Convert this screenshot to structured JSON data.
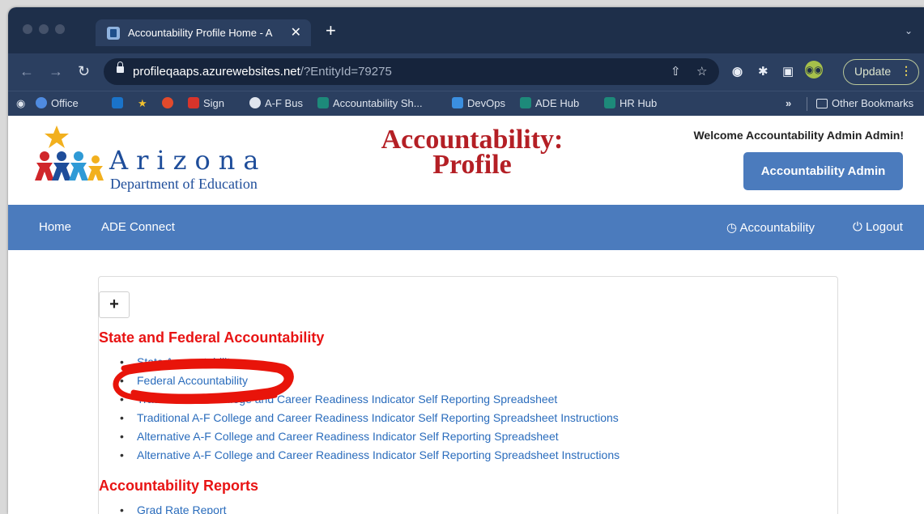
{
  "browser": {
    "tab_title": "Accountability Profile Home - A",
    "tab_close": "✕",
    "new_tab": "+",
    "url_host": "profileqaaps.azurewebsites.net",
    "url_path": "/?EntityId=79275",
    "update_label": "Update",
    "update_menu": "⋮",
    "bookmarks": [
      "Office",
      "Sign",
      "A-F Bus",
      "Accountability Sh...",
      "DevOps",
      "ADE Hub",
      "HR Hub"
    ],
    "more_bookmarks": "»",
    "other_bookmarks": "Other Bookmarks"
  },
  "header": {
    "logo_word": "Arizona",
    "logo_dept": "Department of Education",
    "site_title_1": "Accountability:",
    "site_title_2": "Profile",
    "welcome": "Welcome Accountability Admin Admin!",
    "role_button": "Accountability Admin"
  },
  "nav": {
    "home": "Home",
    "ade_connect": "ADE Connect",
    "accountability": "Accountability",
    "logout": "Logout"
  },
  "content": {
    "expand_button": "+",
    "section1_title": "State and Federal Accountability",
    "section1_items": [
      "State Accountability",
      "Federal Accountability",
      "Traditional A-F College and Career Readiness Indicator Self Reporting Spreadsheet",
      "Traditional A-F College and Career Readiness Indicator Self Reporting Spreadsheet Instructions",
      "Alternative A-F College and Career Readiness Indicator Self Reporting Spreadsheet",
      "Alternative A-F College and Career Readiness Indicator Self Reporting Spreadsheet Instructions"
    ],
    "section2_title": "Accountability Reports",
    "section2_items": [
      "Grad Rate Report"
    ]
  },
  "colors": {
    "chrome": "#1e2f4a",
    "nav_blue": "#4b7bbd",
    "heading_red": "#e81414",
    "title_red": "#b41f25",
    "link_blue": "#2a6cbc",
    "annotation_red": "#e8140a"
  }
}
